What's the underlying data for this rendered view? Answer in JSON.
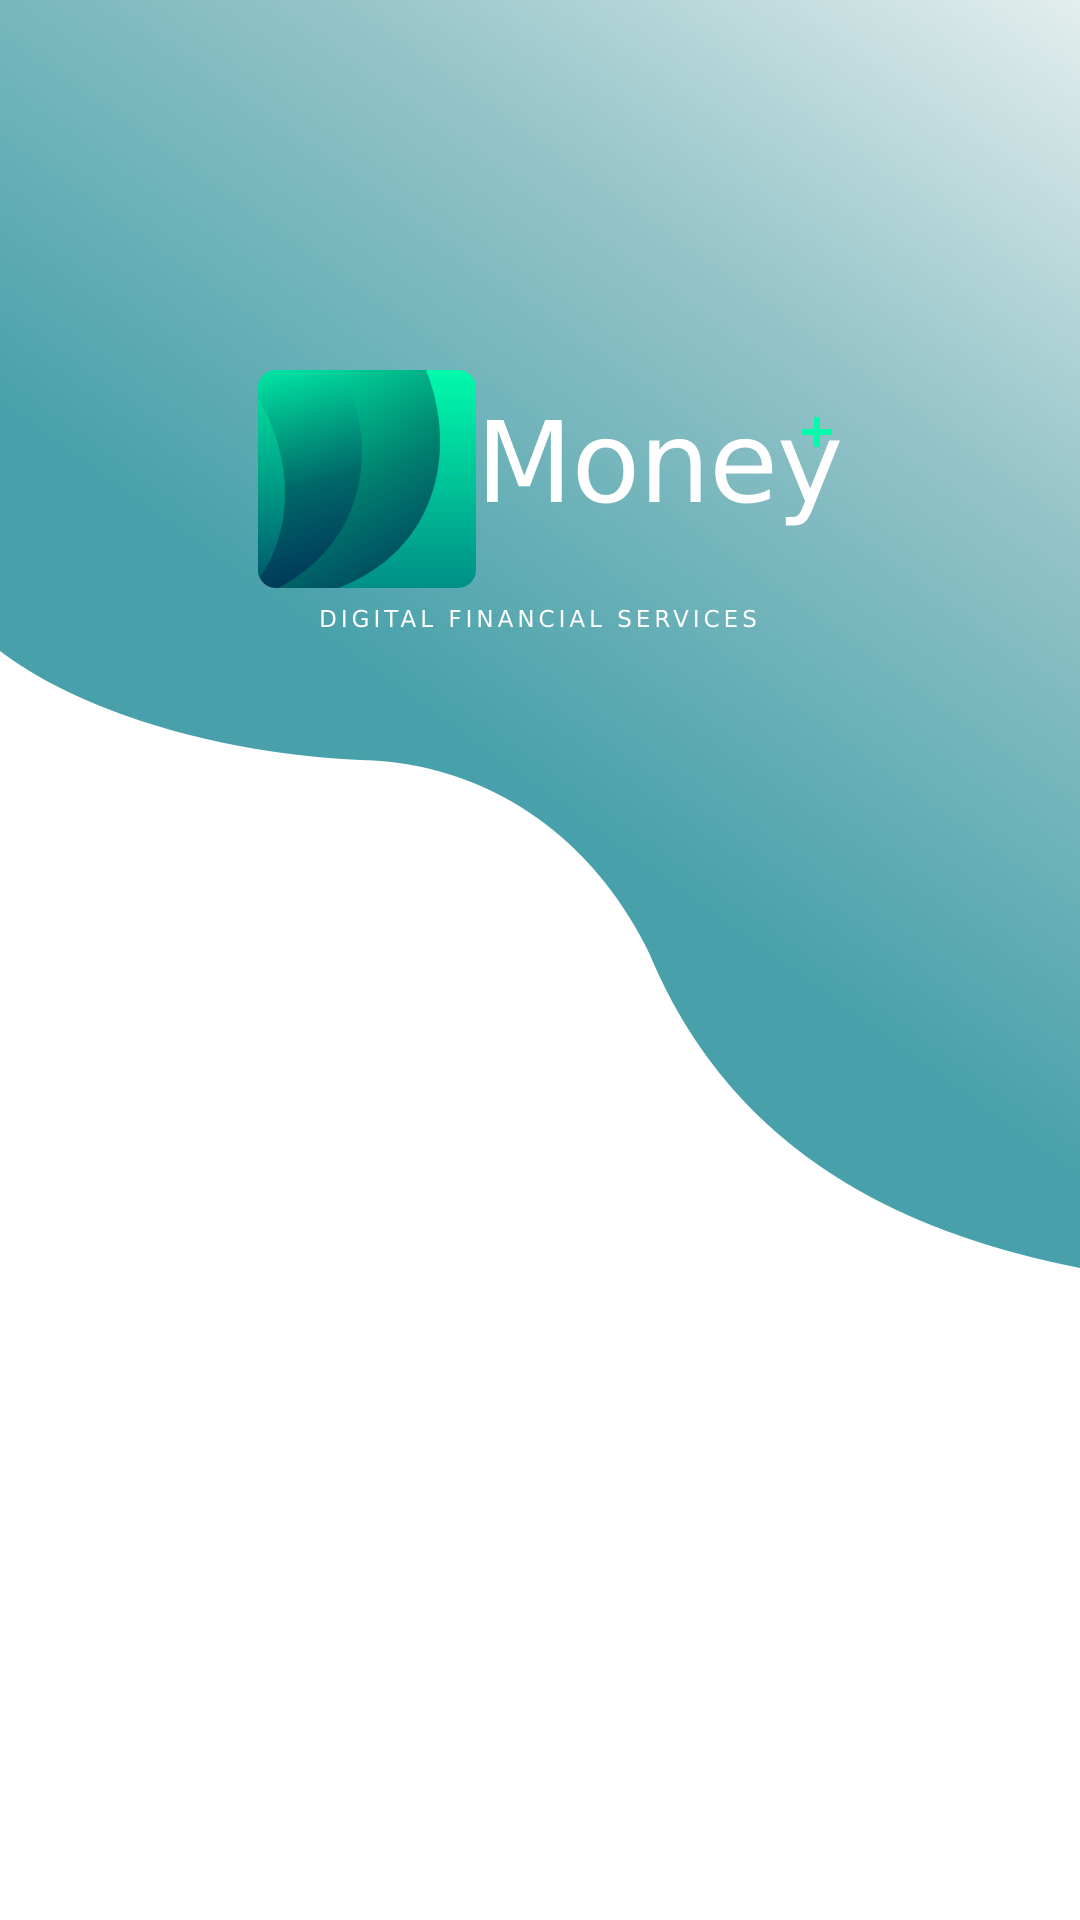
{
  "brand": {
    "name": "Money",
    "tagline": "DIGITAL FINANCIAL SERVICES",
    "logo_icon": "layered-waves-logo-icon",
    "plus_icon": "plus-icon"
  },
  "colors": {
    "teal": "#48a1aa",
    "teal_light": "#e3eeed",
    "mint": "#00fbab",
    "navy": "#003458",
    "white": "#ffffff"
  }
}
